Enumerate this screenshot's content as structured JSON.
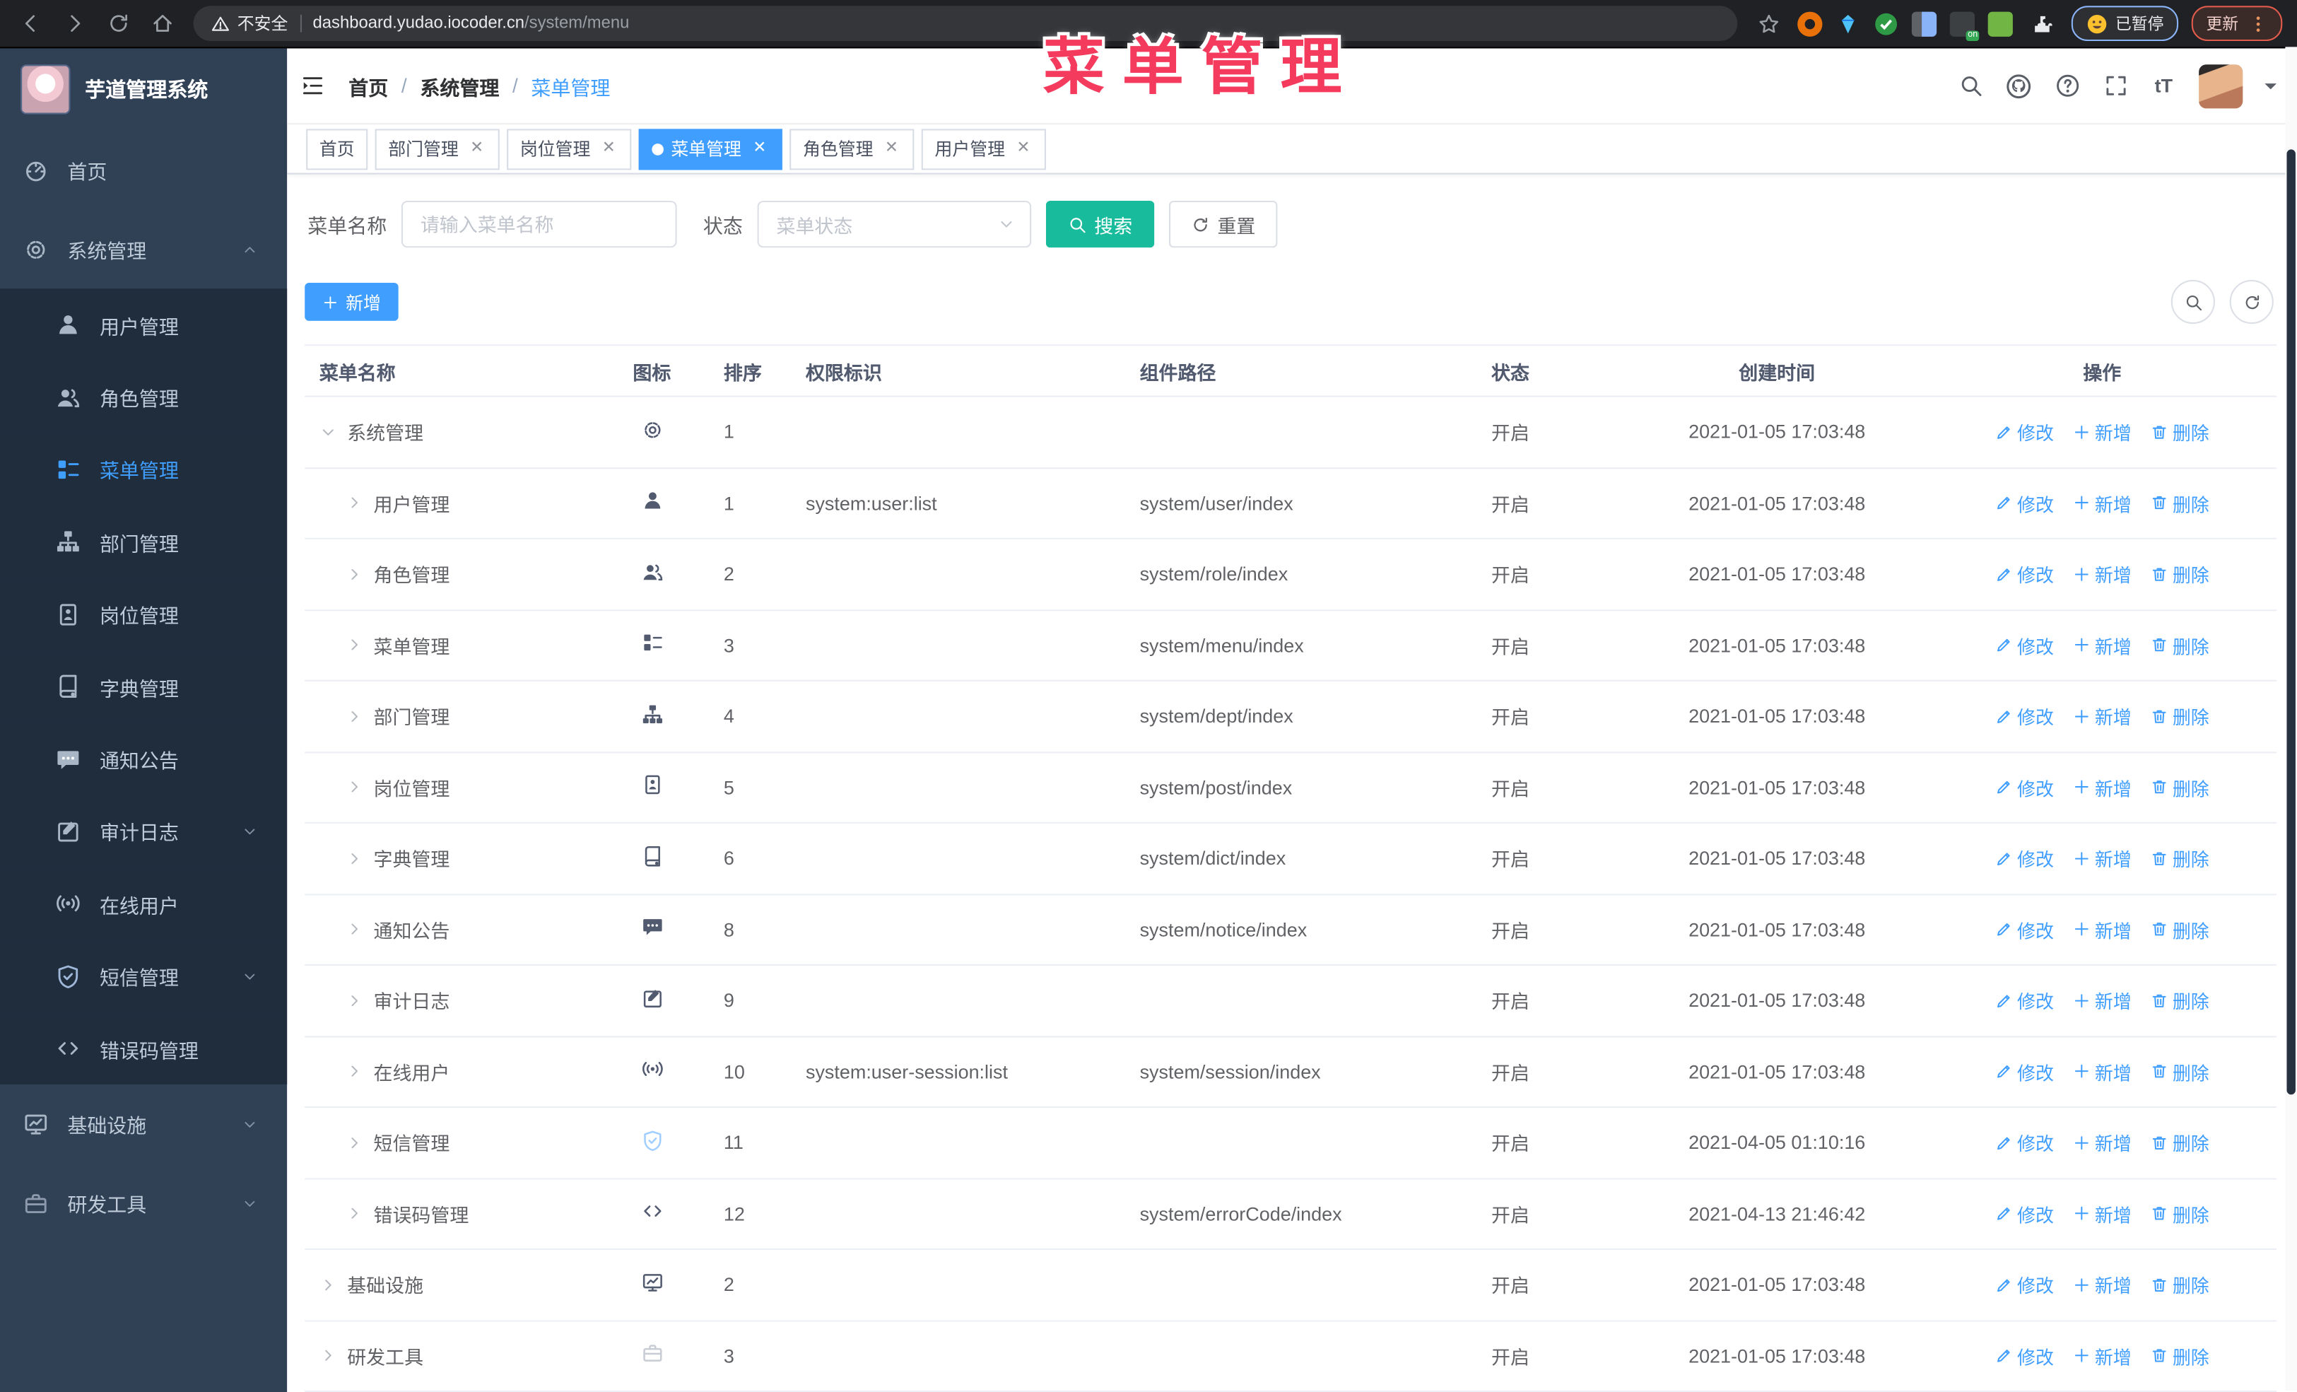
{
  "colors": {
    "accent": "#409eff",
    "search_button": "#18bc9c",
    "add_button": "#409eff",
    "annotation": "#f43b5e",
    "sidebar_bg": "#304156",
    "submenu_bg": "#1f2d3d",
    "tag_active_bg": "#409eff",
    "status_text": "#606266"
  },
  "browser": {
    "security_label": "不安全",
    "url_domain": "dashboard.yudao.iocoder.cn",
    "url_path": "/system/menu",
    "paused_label": "已暂停",
    "update_label": "更新"
  },
  "annotation": {
    "text": "菜单管理"
  },
  "sidebar": {
    "title": "芋道管理系统",
    "items": [
      {
        "label": "首页",
        "icon": "dashboard-icon",
        "level": 0
      },
      {
        "label": "系统管理",
        "icon": "gear-icon",
        "level": 0,
        "expanded": true,
        "arrow": "up"
      },
      {
        "label": "用户管理",
        "icon": "user-icon",
        "level": 1
      },
      {
        "label": "角色管理",
        "icon": "users-icon",
        "level": 1
      },
      {
        "label": "菜单管理",
        "icon": "menu-tree-icon",
        "level": 1,
        "active": true
      },
      {
        "label": "部门管理",
        "icon": "org-tree-icon",
        "level": 1
      },
      {
        "label": "岗位管理",
        "icon": "id-card-icon",
        "level": 1
      },
      {
        "label": "字典管理",
        "icon": "dictionary-icon",
        "level": 1
      },
      {
        "label": "通知公告",
        "icon": "megaphone-icon",
        "level": 1
      },
      {
        "label": "审计日志",
        "icon": "audit-log-icon",
        "level": 1,
        "arrow": "down"
      },
      {
        "label": "在线用户",
        "icon": "online-signal-icon",
        "level": 1
      },
      {
        "label": "短信管理",
        "icon": "shield-check-icon",
        "level": 1,
        "arrow": "down",
        "tint": "light"
      },
      {
        "label": "错误码管理",
        "icon": "code-icon",
        "level": 1
      },
      {
        "label": "基础设施",
        "icon": "infrastructure-icon",
        "level": 0,
        "arrow": "down"
      },
      {
        "label": "研发工具",
        "icon": "toolbox-icon",
        "level": 0,
        "arrow": "down",
        "tint": "pale"
      }
    ]
  },
  "header": {
    "breadcrumb": [
      "首页",
      "系统管理",
      "菜单管理"
    ]
  },
  "tags": [
    {
      "label": "首页",
      "closable": false,
      "active": false
    },
    {
      "label": "部门管理",
      "closable": true,
      "active": false
    },
    {
      "label": "岗位管理",
      "closable": true,
      "active": false
    },
    {
      "label": "菜单管理",
      "closable": true,
      "active": true
    },
    {
      "label": "角色管理",
      "closable": true,
      "active": false
    },
    {
      "label": "用户管理",
      "closable": true,
      "active": false
    }
  ],
  "filters": {
    "name_label": "菜单名称",
    "name_placeholder": "请输入菜单名称",
    "status_label": "状态",
    "status_placeholder": "菜单状态",
    "search_label": "搜索",
    "reset_label": "重置"
  },
  "toolbar": {
    "add_label": "新增"
  },
  "table": {
    "columns": [
      "菜单名称",
      "图标",
      "排序",
      "权限标识",
      "组件路径",
      "状态",
      "创建时间",
      "操作"
    ],
    "action_labels": [
      "修改",
      "新增",
      "删除"
    ],
    "rows": [
      {
        "name": "系统管理",
        "level": 0,
        "expanded": true,
        "icon": "gear-icon",
        "sort": "1",
        "perm": "",
        "path": "",
        "status": "开启",
        "time": "2021-01-05 17:03:48"
      },
      {
        "name": "用户管理",
        "level": 1,
        "expanded": false,
        "icon": "user-icon",
        "sort": "1",
        "perm": "system:user:list",
        "path": "system/user/index",
        "status": "开启",
        "time": "2021-01-05 17:03:48"
      },
      {
        "name": "角色管理",
        "level": 1,
        "expanded": false,
        "icon": "users-icon",
        "sort": "2",
        "perm": "",
        "path": "system/role/index",
        "status": "开启",
        "time": "2021-01-05 17:03:48"
      },
      {
        "name": "菜单管理",
        "level": 1,
        "expanded": false,
        "icon": "menu-tree-icon",
        "sort": "3",
        "perm": "",
        "path": "system/menu/index",
        "status": "开启",
        "time": "2021-01-05 17:03:48"
      },
      {
        "name": "部门管理",
        "level": 1,
        "expanded": false,
        "icon": "org-tree-icon",
        "sort": "4",
        "perm": "",
        "path": "system/dept/index",
        "status": "开启",
        "time": "2021-01-05 17:03:48"
      },
      {
        "name": "岗位管理",
        "level": 1,
        "expanded": false,
        "icon": "id-card-icon",
        "sort": "5",
        "perm": "",
        "path": "system/post/index",
        "status": "开启",
        "time": "2021-01-05 17:03:48"
      },
      {
        "name": "字典管理",
        "level": 1,
        "expanded": false,
        "icon": "dictionary-icon",
        "sort": "6",
        "perm": "",
        "path": "system/dict/index",
        "status": "开启",
        "time": "2021-01-05 17:03:48"
      },
      {
        "name": "通知公告",
        "level": 1,
        "expanded": false,
        "icon": "megaphone-icon",
        "sort": "8",
        "perm": "",
        "path": "system/notice/index",
        "status": "开启",
        "time": "2021-01-05 17:03:48"
      },
      {
        "name": "审计日志",
        "level": 1,
        "expanded": false,
        "icon": "audit-log-icon",
        "sort": "9",
        "perm": "",
        "path": "",
        "status": "开启",
        "time": "2021-01-05 17:03:48"
      },
      {
        "name": "在线用户",
        "level": 1,
        "expanded": false,
        "icon": "online-signal-icon",
        "sort": "10",
        "perm": "system:user-session:list",
        "path": "system/session/index",
        "status": "开启",
        "time": "2021-01-05 17:03:48"
      },
      {
        "name": "短信管理",
        "level": 1,
        "expanded": false,
        "icon": "shield-check-icon",
        "sort": "11",
        "perm": "",
        "path": "",
        "status": "开启",
        "time": "2021-04-05 01:10:16",
        "tint": "blue"
      },
      {
        "name": "错误码管理",
        "level": 1,
        "expanded": false,
        "icon": "code-icon",
        "sort": "12",
        "perm": "",
        "path": "system/errorCode/index",
        "status": "开启",
        "time": "2021-04-13 21:46:42"
      },
      {
        "name": "基础设施",
        "level": 0,
        "expanded": false,
        "icon": "infrastructure-icon",
        "sort": "2",
        "perm": "",
        "path": "",
        "status": "开启",
        "time": "2021-01-05 17:03:48"
      },
      {
        "name": "研发工具",
        "level": 0,
        "expanded": false,
        "icon": "toolbox-icon",
        "sort": "3",
        "perm": "",
        "path": "",
        "status": "开启",
        "time": "2021-01-05 17:03:48",
        "tint": "grey"
      }
    ]
  }
}
